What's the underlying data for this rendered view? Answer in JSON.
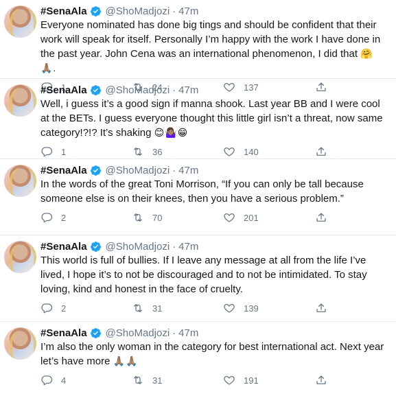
{
  "tweets": [
    {
      "name": "#SenaAla",
      "handle": "@ShoMadjozi",
      "time": "47m",
      "text": "Everyone nominated has done big tings and should be confident that their work will speak for itself. Personally I’m happy with the work I have done in the past year. John Cena was an international phenomenon, I did that",
      "emoji": "🤗🙏🏽.",
      "replies": "1",
      "retweets": "24",
      "likes": "137"
    },
    {
      "name": "#SenaAla",
      "handle": "@ShoMadjozi",
      "time": "47m",
      "text": "Well, i guess it’s a good sign if manna shook. Last year BB and I were cool at the BETs. I guess everyone thought this little girl isn’t a threat, now same category!?!? It’s shaking",
      "emoji": "😊🤷🏽‍♀️😁",
      "replies": "1",
      "retweets": "36",
      "likes": "140"
    },
    {
      "name": "#SenaAla",
      "handle": "@ShoMadjozi",
      "time": "47m",
      "text": "In the words of the great Toni Morrison, “If you can only be tall because someone else is on their knees, then you have a serious problem.”",
      "emoji": "",
      "replies": "2",
      "retweets": "70",
      "likes": "201"
    },
    {
      "name": "#SenaAla",
      "handle": "@ShoMadjozi",
      "time": "47m",
      "text": "This world is full of bullies. If I leave any message at all from the life I’ve lived, I hope it’s to not be discouraged and to not be intimidated. To stay loving, kind and honest in the face of cruelty.",
      "emoji": "",
      "replies": "2",
      "retweets": "31",
      "likes": "139"
    },
    {
      "name": "#SenaAla",
      "handle": "@ShoMadjozi",
      "time": "47m",
      "text": "I’m also the only woman in the category for best international act. Next year let’s have more",
      "emoji": "🙏🏽🙏🏽",
      "replies": "4",
      "retweets": "31",
      "likes": "191"
    }
  ],
  "colors": {
    "accent": "#1da1f2",
    "muted": "#657786",
    "text": "#14171a",
    "divider": "#e6ecf0"
  },
  "icons": {
    "reply": "reply-icon",
    "retweet": "retweet-icon",
    "like": "heart-icon",
    "share": "share-icon",
    "verified": "verified-badge-icon"
  }
}
